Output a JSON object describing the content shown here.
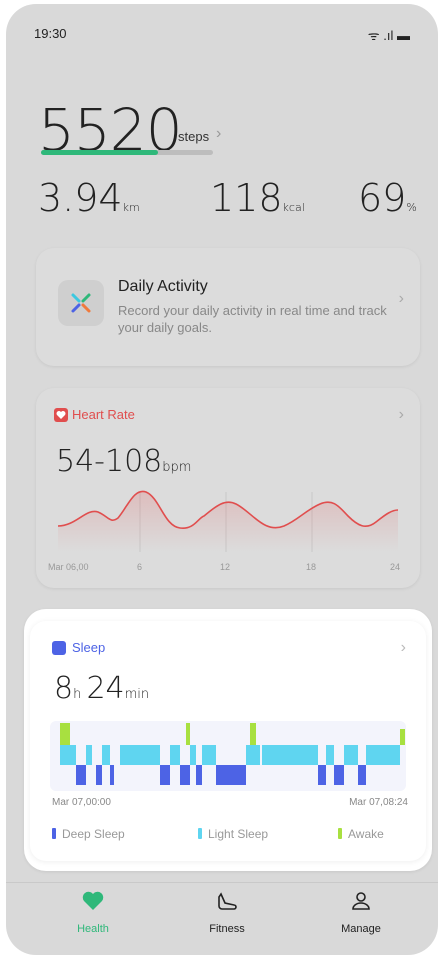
{
  "status_bar": {
    "time": "19:30",
    "icons": "ᯤ .ıl ▬"
  },
  "steps": {
    "value": "5520",
    "unit": "steps",
    "progress_fraction": 0.68
  },
  "metrics": [
    {
      "value": "3.94",
      "unit": "km"
    },
    {
      "value": "118",
      "unit": "kcal"
    },
    {
      "value": "69",
      "unit": "%"
    }
  ],
  "daily_activity": {
    "title": "Daily Activity",
    "description": "Record your daily activity in real time and track your daily goals."
  },
  "heart_rate": {
    "label": "Heart Rate",
    "value": "54-108",
    "unit": "bpm",
    "color": "#e04e4e",
    "x_ticks": [
      "Mar 06,00",
      "6",
      "12",
      "18",
      "24"
    ]
  },
  "sleep": {
    "label": "Sleep",
    "hours": "8",
    "hours_unit": "h",
    "minutes": "24",
    "minutes_unit": "min",
    "start_time": "Mar 07,00:00",
    "end_time": "Mar 07,08:24",
    "legend": [
      {
        "label": "Deep Sleep",
        "color": "#4d63e5"
      },
      {
        "label": "Light Sleep",
        "color": "#5fd5f0"
      },
      {
        "label": "Awake",
        "color": "#a8e040"
      }
    ]
  },
  "tabs": [
    {
      "label": "Health",
      "icon": "heart-icon",
      "active": true
    },
    {
      "label": "Fitness",
      "icon": "shoe-icon",
      "active": false
    },
    {
      "label": "Manage",
      "icon": "person-icon",
      "active": false
    }
  ],
  "chevron": "›"
}
